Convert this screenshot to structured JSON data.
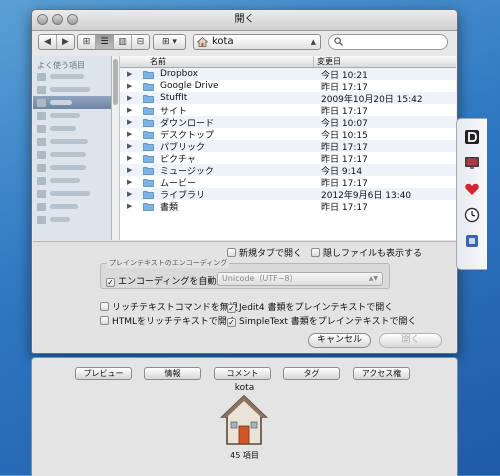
{
  "window": {
    "title": "開く"
  },
  "toolbar": {
    "back": "◀",
    "forward": "▶",
    "view_modes": [
      "⊞",
      "☰",
      "▥",
      "⊟"
    ],
    "arrange": "⊞ ▾",
    "location": "kota",
    "search_placeholder": ""
  },
  "sidebar": {
    "header": "よく使う項目",
    "items": [
      {
        "blur_w": 34,
        "selected": false
      },
      {
        "blur_w": 40,
        "selected": false
      },
      {
        "blur_w": 22,
        "selected": true
      },
      {
        "blur_w": 30,
        "selected": false
      },
      {
        "blur_w": 26,
        "selected": false
      },
      {
        "blur_w": 38,
        "selected": false
      },
      {
        "blur_w": 36,
        "selected": false
      },
      {
        "blur_w": 36,
        "selected": false
      },
      {
        "blur_w": 30,
        "selected": false
      },
      {
        "blur_w": 40,
        "selected": false
      },
      {
        "blur_w": 28,
        "selected": false
      },
      {
        "blur_w": 20,
        "selected": false
      }
    ]
  },
  "list": {
    "col_name": "名前",
    "col_date": "変更日",
    "rows": [
      {
        "name": "Dropbox",
        "date": "今日 10:21"
      },
      {
        "name": "Google Drive",
        "date": "昨日 17:17"
      },
      {
        "name": "StuffIt",
        "date": "2009年10月20日 15:42"
      },
      {
        "name": "サイト",
        "date": "昨日 17:17"
      },
      {
        "name": "ダウンロード",
        "date": "今日 10:07"
      },
      {
        "name": "デスクトップ",
        "date": "今日 10:15"
      },
      {
        "name": "パブリック",
        "date": "昨日 17:17"
      },
      {
        "name": "ピクチャ",
        "date": "昨日 17:17"
      },
      {
        "name": "ミュージック",
        "date": "今日 9:14"
      },
      {
        "name": "ムービー",
        "date": "昨日 17:17"
      },
      {
        "name": "ライブラリ",
        "date": "2012年9月6日 13:40"
      },
      {
        "name": "書類",
        "date": "昨日 17:17"
      }
    ]
  },
  "options": {
    "new_tab": "新規タブで開く",
    "show_hidden": "隠しファイルも表示する",
    "encoding_group": "プレインテキストのエンコーディング",
    "auto_encoding": "エンコーディングを自動判定",
    "encoding_value": "Unicode（UTF−8）",
    "ignore_rtf": "リッチテキストコマンドを無視",
    "jedit4_plain": "Jedit4 書類をプレインテキストで開く",
    "html_rich": "HTMLをリッチテキストで開く",
    "simpletext_plain": "SimpleText 書類をプレインテキストで開く",
    "cancel": "キャンセル",
    "open": "開く"
  },
  "info": {
    "buttons": [
      "プレビュー",
      "情報",
      "コメント",
      "タグ",
      "アクセス権"
    ],
    "title": "kota",
    "count": "45 項目"
  },
  "dock": {
    "icons": [
      "dictionary-icon",
      "display-icon",
      "heart-icon",
      "clock-icon",
      "app-icon"
    ]
  }
}
